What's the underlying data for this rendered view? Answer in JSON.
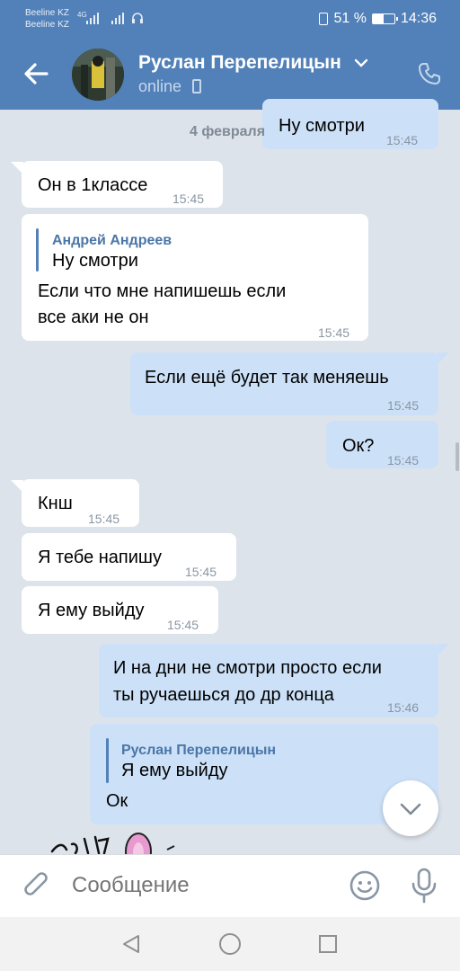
{
  "status_bar": {
    "carrier_1": "Beeline KZ",
    "carrier_2": "Beeline KZ",
    "network": "4G",
    "battery_text": "51 %",
    "battery_level": 0.51,
    "time": "14:36"
  },
  "header": {
    "contact_name": "Руслан Перепелицын",
    "presence": "online"
  },
  "chat": {
    "date_label": "4 февраля",
    "messages": [
      {
        "dir": "out",
        "text": "Ну смотри",
        "time": "15:45"
      },
      {
        "dir": "in",
        "text": "Он в 1классе",
        "time": "15:45"
      },
      {
        "dir": "in",
        "reply_author": "Андрей Андреев",
        "reply_text": "Ну смотри",
        "text_line1": "Если что мне напишешь если",
        "text_line2": "все аки не он",
        "time": "15:45"
      },
      {
        "dir": "out",
        "text": "Если ещё будет так меняешь",
        "time": "15:45"
      },
      {
        "dir": "out",
        "text": "Ок?",
        "time": "15:45"
      },
      {
        "dir": "in",
        "text": "Кнш",
        "time": "15:45"
      },
      {
        "dir": "in",
        "text": "Я тебе напишу",
        "time": "15:45"
      },
      {
        "dir": "in",
        "text": "Я ему выйду",
        "time": "15:45"
      },
      {
        "dir": "out",
        "text_line1": "И на дни не смотри просто если",
        "text_line2": "ты ручаешься до др конца",
        "time": "15:46"
      },
      {
        "dir": "out",
        "reply_author": "Руслан Перепелицын",
        "reply_text": "Я ему выйду",
        "text": "Ок"
      }
    ]
  },
  "composer": {
    "placeholder": "Сообщение"
  },
  "colors": {
    "header": "#5181b8",
    "outgoing_bubble": "#cce0f7",
    "incoming_bubble": "#ffffff",
    "background": "#dde3ea"
  }
}
